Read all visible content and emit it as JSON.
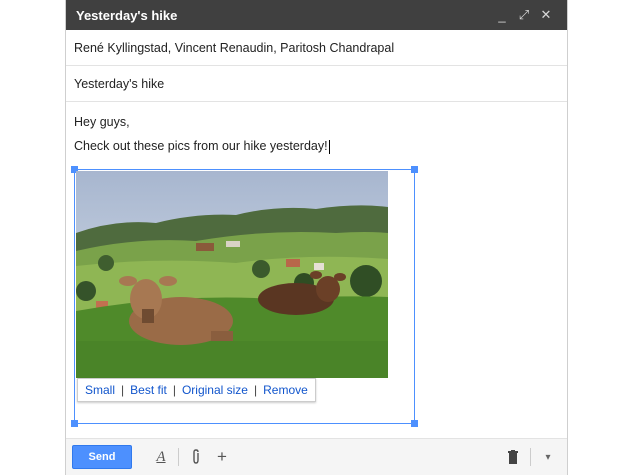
{
  "window": {
    "title": "Yesterday's hike",
    "minimize_symbol": "_",
    "maximize_symbol": "⤢",
    "close_symbol": "✕"
  },
  "recipients": "René Kyllingstad, Vincent Renaudin, Paritosh Chandrapal",
  "subject": "Yesterday's hike",
  "message": {
    "line1": "Hey guys,",
    "line2": "Check out these pics from our hike yesterday!"
  },
  "image_size_options": {
    "small": "Small",
    "separator": "|",
    "best_fit": "Best fit",
    "original_size": "Original size",
    "remove": "Remove"
  },
  "toolbar": {
    "send_label": "Send",
    "formatting_icon": "A",
    "attach_icon": "paperclip-icon",
    "more_icon": "+",
    "trash_icon": "trash-icon",
    "more_options_icon": "▾"
  },
  "colors": {
    "titlebar": "#404040",
    "accent": "#4d90fe",
    "link": "#1155cc"
  }
}
